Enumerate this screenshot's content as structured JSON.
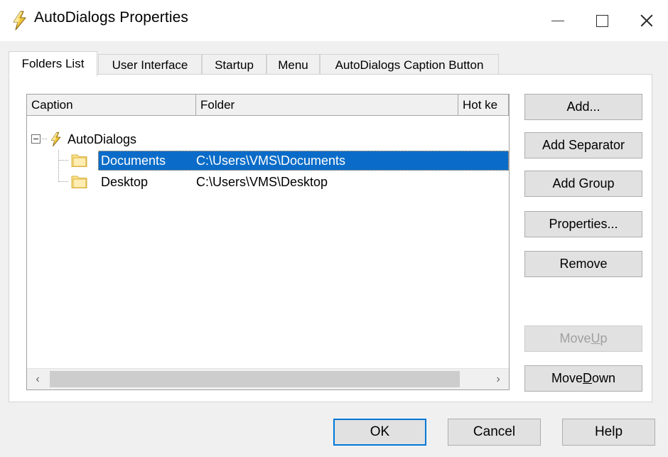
{
  "window": {
    "title": "AutoDialogs Properties",
    "icon": "lightning-bolt-icon",
    "controls": {
      "minimize": "—",
      "maximize": "□",
      "close": "✕"
    }
  },
  "tabs": [
    {
      "label": "Folders List",
      "active": true
    },
    {
      "label": "User Interface",
      "active": false
    },
    {
      "label": "Startup",
      "active": false
    },
    {
      "label": "Menu",
      "active": false
    },
    {
      "label": "AutoDialogs Caption Button",
      "active": false
    }
  ],
  "list": {
    "columns": [
      {
        "label": "Caption"
      },
      {
        "label": "Folder"
      },
      {
        "label": "Hot ke"
      }
    ],
    "rows": [
      {
        "caption": "AutoDialogs",
        "folder": "",
        "hotkey": "",
        "level": 0,
        "icon": "lightning-bolt-icon",
        "expanded": true,
        "selected": false
      },
      {
        "caption": "Documents",
        "folder": "C:\\Users\\VMS\\Documents",
        "hotkey": "",
        "level": 1,
        "icon": "folder-icon",
        "expanded": false,
        "selected": true
      },
      {
        "caption": "Desktop",
        "folder": "C:\\Users\\VMS\\Desktop",
        "hotkey": "",
        "level": 1,
        "icon": "folder-icon",
        "expanded": false,
        "selected": false
      }
    ],
    "scrollbar": {
      "left_arrow": "‹",
      "right_arrow": "›"
    }
  },
  "side_buttons": [
    {
      "label": "Add...",
      "disabled": false
    },
    {
      "label": "Add Separator",
      "disabled": false
    },
    {
      "label": "Add Group",
      "disabled": false
    },
    {
      "label": "Properties...",
      "disabled": false
    },
    {
      "label": "Remove",
      "disabled": false
    }
  ],
  "move_buttons": {
    "move_up": {
      "pre": "Move ",
      "mnemonic": "U",
      "post": "p",
      "disabled": true
    },
    "move_down": {
      "pre": "Move ",
      "mnemonic": "D",
      "post": "own",
      "disabled": false
    }
  },
  "dialog_buttons": [
    {
      "label": "OK",
      "default": true
    },
    {
      "label": "Cancel",
      "default": false
    },
    {
      "label": "Help",
      "default": false
    }
  ],
  "colors": {
    "selection": "#0a6cc8",
    "focus_border": "#0078d7",
    "dialog_bg": "#f0f0f0",
    "panel_bg": "#ffffff",
    "accent_icon": "#e8b923"
  }
}
